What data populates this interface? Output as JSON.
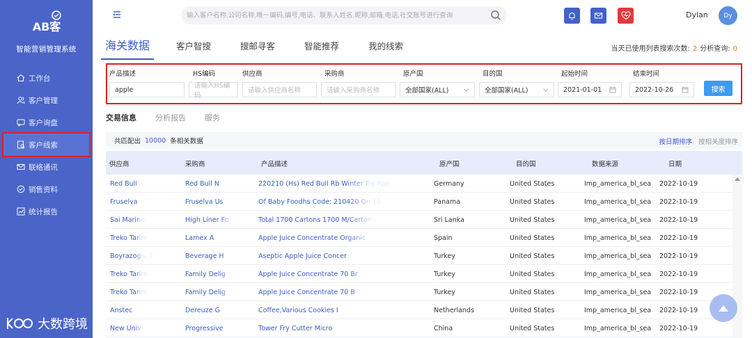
{
  "sidebar": {
    "logo_text": "AB客",
    "brand_name": "智能营销管理系统",
    "items": [
      {
        "label": "工作台",
        "icon": "home-icon"
      },
      {
        "label": "客户管理",
        "icon": "users-icon"
      },
      {
        "label": "客户询盘",
        "icon": "inquiry-icon"
      },
      {
        "label": "客户线索",
        "icon": "clue-icon"
      },
      {
        "label": "联络通讯",
        "icon": "mail-icon"
      },
      {
        "label": "销售资料",
        "icon": "material-icon"
      },
      {
        "label": "统计报告",
        "icon": "chart-icon"
      }
    ],
    "active_index": 3,
    "watermark": "大数跨境"
  },
  "topbar": {
    "search_placeholder": "输入客户名称,公司名称,唯一编码,编号,电话、联系人姓名,昵称,邮箱,电话,社交账号进行查询",
    "user_name": "Dylan",
    "avatar_text": "Dy",
    "icons": [
      "bell-icon",
      "message-icon",
      "heart-icon"
    ],
    "colors": {
      "bell": "#4361c9",
      "message": "#4361c9",
      "heart": "#e03a3a"
    }
  },
  "tabs": [
    {
      "label": "海关数据",
      "active": true
    },
    {
      "label": "客户智搜",
      "active": false
    },
    {
      "label": "搜邮寻客",
      "active": false
    },
    {
      "label": "智能推荐",
      "active": false
    },
    {
      "label": "我的线索",
      "active": false
    }
  ],
  "usage": {
    "prefix": "当天已使用列表搜索次数:",
    "search_count": "2",
    "analysis_label": "分析查询:",
    "analysis_count": "0"
  },
  "filters": {
    "product": {
      "label": "产品描述",
      "value": "apple"
    },
    "hs": {
      "label": "HS编码",
      "placeholder": "请输入HS编码"
    },
    "supplier": {
      "label": "供应商",
      "placeholder": "请输入供应商名称"
    },
    "buyer": {
      "label": "采购商",
      "placeholder": "请输入采购商名称"
    },
    "origin": {
      "label": "原产国",
      "value": "全部国家(ALL)"
    },
    "dest": {
      "label": "目的国",
      "value": "全部国家(ALL)"
    },
    "start": {
      "label": "起始时间",
      "value": "2021-01-01"
    },
    "end": {
      "label": "结束时间",
      "value": "2022-10-26"
    },
    "search_button": "搜索"
  },
  "subtabs": [
    {
      "label": "交易信息",
      "active": true
    },
    {
      "label": "分析报告",
      "active": false
    },
    {
      "label": "服务",
      "active": false
    }
  ],
  "results": {
    "prefix": "共匹配出",
    "count": "10000",
    "suffix": "条相关数据",
    "sort_date": "按日期排序",
    "sort_relevance": "按相关度排序"
  },
  "table": {
    "columns": [
      "供应商",
      "采购商",
      "产品描述",
      "原产国",
      "目的国",
      "数据来源",
      "日期"
    ],
    "rows": [
      [
        "Red Bull",
        "Red Bull N",
        "220210 (Hs) Red Bull Rb Winter Fig App",
        "Germany",
        "United States",
        "Imp_america_bl_sea",
        "2022-10-19"
      ],
      [
        "Fruselva",
        "Fruselva Us",
        "Of Baby Foodhs Code: 210420 On 10",
        "Panama",
        "United States",
        "Imp_america_bl_sea",
        "2022-10-19"
      ],
      [
        "Sai Marine",
        "High Liner Fo",
        "Total 1700 Cartons 1700 M/Carton",
        "Sri Lanka",
        "United States",
        "Imp_america_bl_sea",
        "2022-10-19"
      ],
      [
        "Treko Tarim",
        "Lamex A",
        "Apple Juice Concentrate Organic",
        "Spain",
        "United States",
        "Imp_america_bl_sea",
        "2022-10-19"
      ],
      [
        "Boyrazoglu T",
        "Beverage H",
        "Aseptic Apple Juice Concer",
        "Turkey",
        "United States",
        "Imp_america_bl_sea",
        "2022-10-19"
      ],
      [
        "Treko Tarim",
        "Family Delig",
        "Apple Juice Concentrate 70 Br",
        "Turkey",
        "United States",
        "Imp_america_bl_sea",
        "2022-10-19"
      ],
      [
        "Treko Tarim",
        "Family Delig",
        "Apple Juice Concentrate 70 B",
        "Turkey",
        "United States",
        "Imp_america_bl_sea",
        "2022-10-19"
      ],
      [
        "Anstec",
        "Dereuze G",
        "Coffee,Various Cookies I",
        "Netherlands",
        "United States",
        "Imp_america_bl_sea",
        "2022-10-19"
      ],
      [
        "New Univ",
        "Progressive",
        "Tower Fry Cutter Micro",
        "China",
        "United States",
        "Imp_america_bl_sea",
        "2022-10-19"
      ]
    ]
  },
  "accent": "#3b5cc4",
  "highlight": "#e02020"
}
